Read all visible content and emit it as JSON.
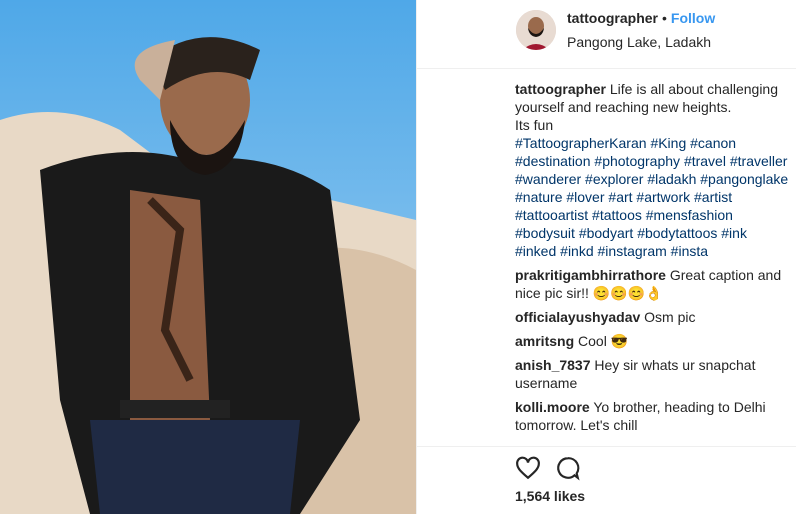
{
  "header": {
    "username": "tattoographer",
    "separator": "•",
    "follow_label": "Follow",
    "location": "Pangong Lake, Ladakh"
  },
  "caption": {
    "username": "tattoographer",
    "text_lines": [
      "Life is all about challenging",
      "yourself and reaching new heights.",
      "Its fun"
    ],
    "hashtags": [
      "#TattoographerKaran",
      "#King",
      "#canon",
      "#destination",
      "#photography",
      "#travel",
      "#traveller",
      "#wanderer",
      "#explorer",
      "#ladakh",
      "#pangonglake",
      "#nature",
      "#lover",
      "#art",
      "#artwork",
      "#artist",
      "#tattooartist",
      "#tattoos",
      "#mensfashion",
      "#bodysuit",
      "#bodyart",
      "#bodytattoos",
      "#ink",
      "#inked",
      "#inkd",
      "#instagram",
      "#insta"
    ]
  },
  "comments": [
    {
      "user": "prakritigambhirrathore",
      "text": "Great caption and nice pic sir!! 😊😊😊👌"
    },
    {
      "user": "officialayushyadav",
      "text": "Osm pic"
    },
    {
      "user": "amritsng",
      "text": "Cool 😎"
    },
    {
      "user": "anish_7837",
      "text": "Hey sir whats ur snapchat username"
    },
    {
      "user": "kolli.moore",
      "text": "Yo brother, heading to Delhi tomorrow. Let's chill"
    }
  ],
  "actions": {
    "like_icon": "heart-icon",
    "comment_icon": "comment-icon"
  },
  "likes_text": "1,564 likes"
}
